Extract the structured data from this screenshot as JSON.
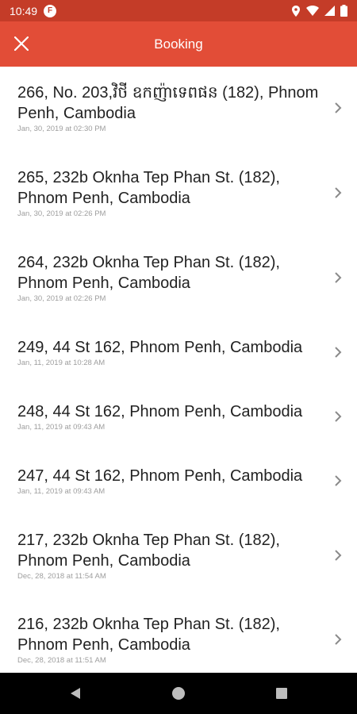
{
  "status_bar": {
    "time": "10:49",
    "app_badge": "F"
  },
  "app_bar": {
    "title": "Booking",
    "close_icon": "close-icon"
  },
  "bookings": [
    {
      "title": "266, No. 203,វិថី ឧកញ៉ាទេពផន (182), Phnom Penh, Cambodia",
      "date": "Jan, 30, 2019 at 02:30 PM"
    },
    {
      "title": "265, 232b Oknha Tep Phan St. (182), Phnom Penh, Cambodia",
      "date": "Jan, 30, 2019 at 02:26 PM"
    },
    {
      "title": "264, 232b Oknha Tep Phan St. (182), Phnom Penh, Cambodia",
      "date": "Jan, 30, 2019 at 02:26 PM"
    },
    {
      "title": "249, 44 St 162, Phnom Penh, Cambodia",
      "date": "Jan, 11, 2019 at 10:28 AM"
    },
    {
      "title": "248, 44 St 162, Phnom Penh, Cambodia",
      "date": "Jan, 11, 2019 at 09:43 AM"
    },
    {
      "title": "247, 44 St 162, Phnom Penh, Cambodia",
      "date": "Jan, 11, 2019 at 09:43 AM"
    },
    {
      "title": "217, 232b Oknha Tep Phan St. (182), Phnom Penh, Cambodia",
      "date": "Dec, 28, 2018 at 11:54 AM"
    },
    {
      "title": "216, 232b Oknha Tep Phan St. (182), Phnom Penh, Cambodia",
      "date": "Dec, 28, 2018 at 11:51 AM"
    }
  ],
  "colors": {
    "status_bar": "#c43c28",
    "app_bar": "#e24d37",
    "nav_bar": "#000000"
  }
}
